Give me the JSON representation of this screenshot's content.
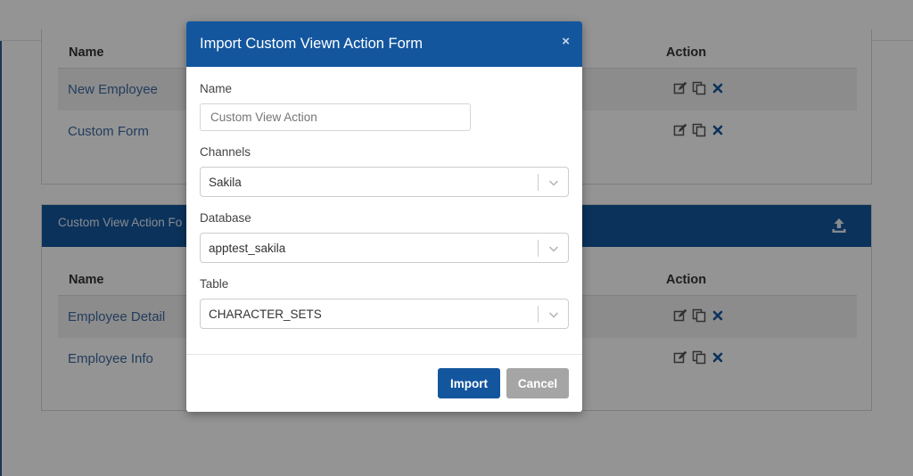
{
  "background": {
    "top_table": {
      "columns": {
        "name": "Name",
        "action": "Action"
      },
      "rows": [
        {
          "name": "New Employee"
        },
        {
          "name": "Custom Form"
        }
      ]
    },
    "section": {
      "title": "Custom View Action Fo",
      "upload_icon": "upload-icon",
      "columns": {
        "name": "Name",
        "action": "Action"
      },
      "rows": [
        {
          "name": "Employee Detail"
        },
        {
          "name": "Employee Info"
        }
      ]
    },
    "row_action_icons": [
      "edit-icon",
      "copy-icon",
      "delete-icon"
    ]
  },
  "modal": {
    "title": "Import Custom Viewn Action Form",
    "close_label": "×",
    "fields": {
      "name": {
        "label": "Name",
        "value": "",
        "placeholder": "Custom View Action"
      },
      "channels": {
        "label": "Channels",
        "value": "Sakila"
      },
      "database": {
        "label": "Database",
        "value": "apptest_sakila"
      },
      "table": {
        "label": "Table",
        "value": "CHARACTER_SETS"
      }
    },
    "buttons": {
      "import": "Import",
      "cancel": "Cancel"
    }
  },
  "colors": {
    "primary": "#13569e",
    "cancel": "#a5a5a5",
    "link_text": "#3d6aa0"
  }
}
